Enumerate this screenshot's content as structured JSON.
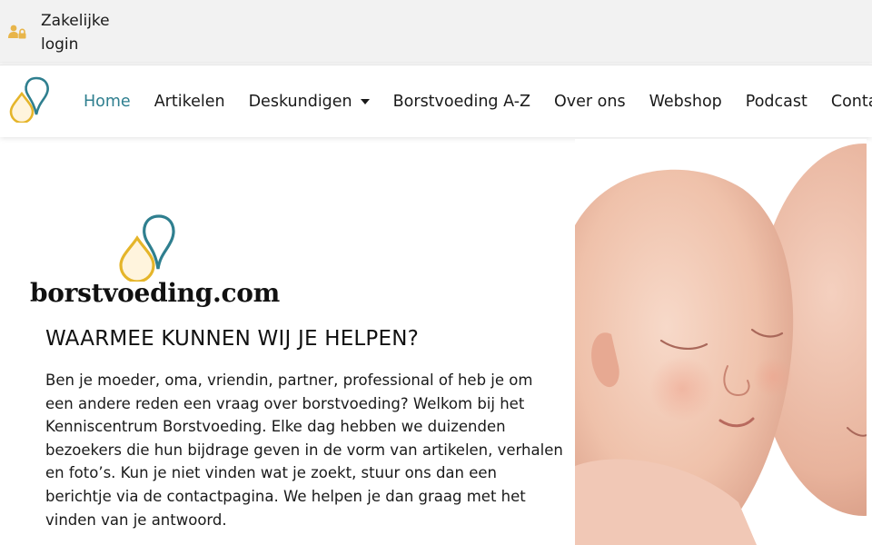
{
  "topbar": {
    "login_label": "Zakelijke login",
    "icon": "users-lock-icon"
  },
  "header": {
    "logo_icon": "borstvoeding-drops-logo-icon",
    "nav": [
      {
        "label": "Home",
        "active": true
      },
      {
        "label": "Artikelen"
      },
      {
        "label": "Deskundigen",
        "has_dropdown": true
      },
      {
        "label": "Borstvoeding A-Z"
      },
      {
        "label": "Over ons"
      },
      {
        "label": "Webshop"
      },
      {
        "label": "Podcast"
      },
      {
        "label": "Contact"
      }
    ]
  },
  "main": {
    "brand_name": "borstvoeding.com",
    "headline": "WAARMEE KUNNEN WIJ JE HELPEN?",
    "intro": "Ben je moeder, oma, vriendin, partner, professional of heb je om een andere reden een vraag over borstvoeding? Welkom bij het Kenniscentrum Borstvoeding. Elke dag hebben we duizenden bezoekers die hun bijdrage geven in de vorm van artikelen, verhalen en foto’s. Kun je niet vinden wat je zoekt, stuur ons dan een berichtje via de contactpagina. We helpen je dan graag met het vinden van je antwoord.",
    "hero_image": "sleeping-babies-photo"
  },
  "colors": {
    "accent_teal": "#2f7f8f",
    "logo_gold": "#e5b52a",
    "logo_teal": "#2f7f8f",
    "topbar_bg": "#f2f2f2",
    "icon_gold": "#e8b54a"
  }
}
